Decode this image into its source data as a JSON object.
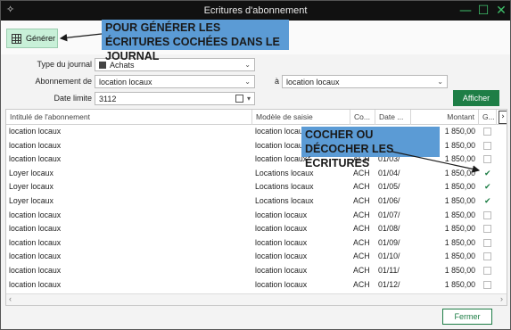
{
  "window": {
    "title": "Ecritures d'abonnement"
  },
  "toolbar": {
    "generate_label": "Générer"
  },
  "callouts": {
    "generate": "POUR GÉNÉRER LES ÉCRITURES COCHÉES DANS LE JOURNAL",
    "check": "COCHER OU DÉCOCHER LES ÉCRITURES"
  },
  "form": {
    "journal_type_label": "Type du journal",
    "journal_type_value": "Achats",
    "subscription_label": "Abonnement de",
    "subscription_from": "location locaux",
    "subscription_to_label": "à",
    "subscription_to": "location locaux",
    "date_limit_label": "Date limite",
    "date_limit_value": "3112",
    "show_button": "Afficher"
  },
  "table": {
    "columns": [
      "Intitulé de l'abonnement",
      "Modèle de saisie",
      "Co...",
      "Date ...",
      "Montant",
      "G..."
    ],
    "rows": [
      {
        "name": "location locaux",
        "model": "location locaux",
        "code": "",
        "date": "",
        "amount": "1 850,00",
        "checked": false
      },
      {
        "name": "location locaux",
        "model": "location locaux",
        "code": "",
        "date": "",
        "amount": "1 850,00",
        "checked": false
      },
      {
        "name": "location locaux",
        "model": "location locaux",
        "code": "ACH",
        "date": "01/03/",
        "amount": "1 850,00",
        "checked": false
      },
      {
        "name": "Loyer locaux",
        "model": "Locations locaux",
        "code": "ACH",
        "date": "01/04/",
        "amount": "1 850,00",
        "checked": true
      },
      {
        "name": "Loyer locaux",
        "model": "Locations locaux",
        "code": "ACH",
        "date": "01/05/",
        "amount": "1 850,00",
        "checked": true
      },
      {
        "name": "Loyer locaux",
        "model": "Locations locaux",
        "code": "ACH",
        "date": "01/06/",
        "amount": "1 850,00",
        "checked": true
      },
      {
        "name": "location locaux",
        "model": "location locaux",
        "code": "ACH",
        "date": "01/07/",
        "amount": "1 850,00",
        "checked": false
      },
      {
        "name": "location locaux",
        "model": "location locaux",
        "code": "ACH",
        "date": "01/08/",
        "amount": "1 850,00",
        "checked": false
      },
      {
        "name": "location locaux",
        "model": "location locaux",
        "code": "ACH",
        "date": "01/09/",
        "amount": "1 850,00",
        "checked": false
      },
      {
        "name": "location locaux",
        "model": "location locaux",
        "code": "ACH",
        "date": "01/10/",
        "amount": "1 850,00",
        "checked": false
      },
      {
        "name": "location locaux",
        "model": "location locaux",
        "code": "ACH",
        "date": "01/11/",
        "amount": "1 850,00",
        "checked": false
      },
      {
        "name": "location locaux",
        "model": "location locaux",
        "code": "ACH",
        "date": "01/12/",
        "amount": "1 850,00",
        "checked": false
      }
    ]
  },
  "footer": {
    "close_button": "Fermer"
  },
  "colors": {
    "accent": "#1e7e46",
    "callout": "#5b9bd5",
    "titlebar": "#111111"
  }
}
